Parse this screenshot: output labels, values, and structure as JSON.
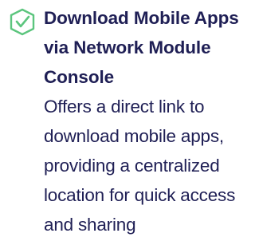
{
  "feature": {
    "title": "Download Mobile Apps via Network Module Console",
    "description": "Offers a direct link to download mobile apps, providing a centralized location for quick access and sharing",
    "icon": "check-shield-icon",
    "colors": {
      "icon": "#5cc57e",
      "text": "#1f1f55"
    }
  }
}
